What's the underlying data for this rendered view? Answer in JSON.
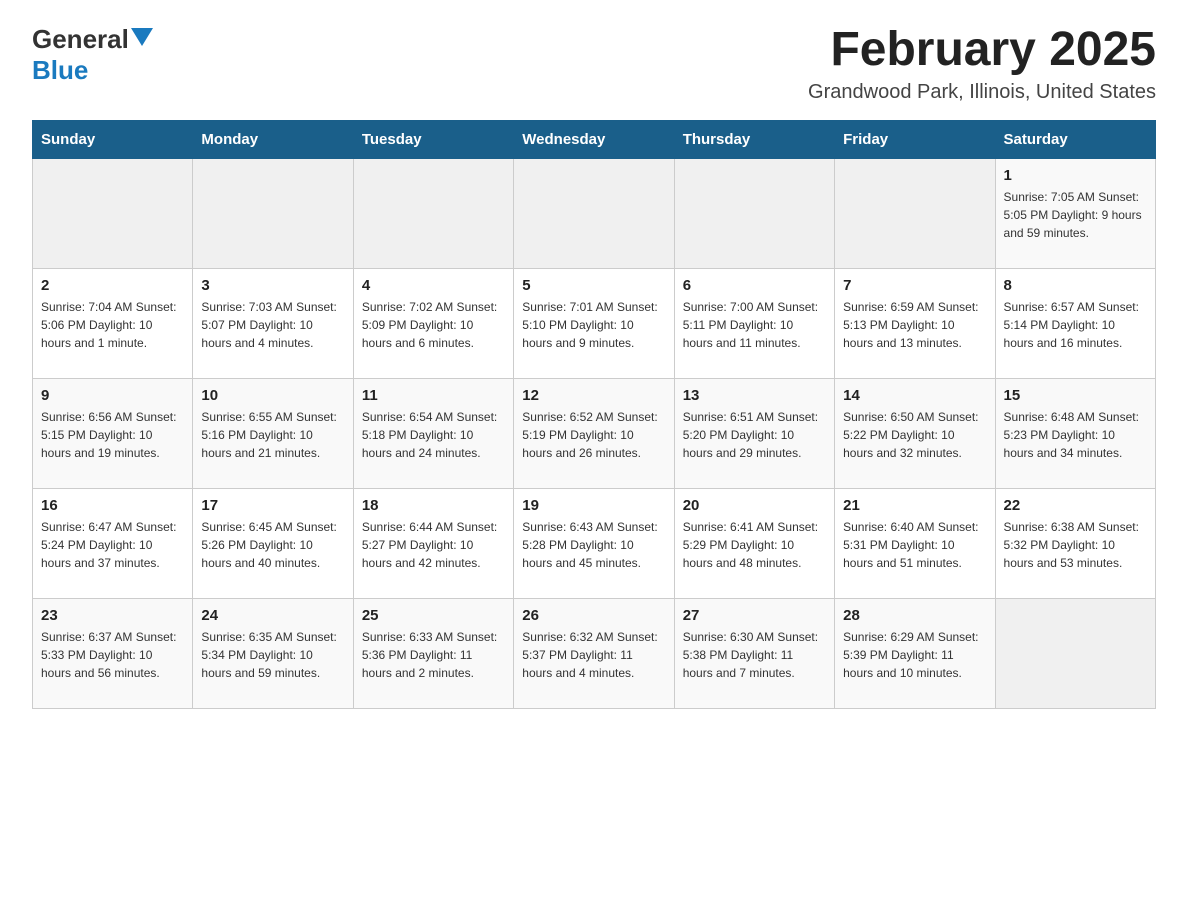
{
  "logo": {
    "general": "General",
    "blue": "Blue"
  },
  "title": "February 2025",
  "subtitle": "Grandwood Park, Illinois, United States",
  "days_of_week": [
    "Sunday",
    "Monday",
    "Tuesday",
    "Wednesday",
    "Thursday",
    "Friday",
    "Saturday"
  ],
  "weeks": [
    [
      {
        "day": "",
        "info": ""
      },
      {
        "day": "",
        "info": ""
      },
      {
        "day": "",
        "info": ""
      },
      {
        "day": "",
        "info": ""
      },
      {
        "day": "",
        "info": ""
      },
      {
        "day": "",
        "info": ""
      },
      {
        "day": "1",
        "info": "Sunrise: 7:05 AM\nSunset: 5:05 PM\nDaylight: 9 hours and 59 minutes."
      }
    ],
    [
      {
        "day": "2",
        "info": "Sunrise: 7:04 AM\nSunset: 5:06 PM\nDaylight: 10 hours and 1 minute."
      },
      {
        "day": "3",
        "info": "Sunrise: 7:03 AM\nSunset: 5:07 PM\nDaylight: 10 hours and 4 minutes."
      },
      {
        "day": "4",
        "info": "Sunrise: 7:02 AM\nSunset: 5:09 PM\nDaylight: 10 hours and 6 minutes."
      },
      {
        "day": "5",
        "info": "Sunrise: 7:01 AM\nSunset: 5:10 PM\nDaylight: 10 hours and 9 minutes."
      },
      {
        "day": "6",
        "info": "Sunrise: 7:00 AM\nSunset: 5:11 PM\nDaylight: 10 hours and 11 minutes."
      },
      {
        "day": "7",
        "info": "Sunrise: 6:59 AM\nSunset: 5:13 PM\nDaylight: 10 hours and 13 minutes."
      },
      {
        "day": "8",
        "info": "Sunrise: 6:57 AM\nSunset: 5:14 PM\nDaylight: 10 hours and 16 minutes."
      }
    ],
    [
      {
        "day": "9",
        "info": "Sunrise: 6:56 AM\nSunset: 5:15 PM\nDaylight: 10 hours and 19 minutes."
      },
      {
        "day": "10",
        "info": "Sunrise: 6:55 AM\nSunset: 5:16 PM\nDaylight: 10 hours and 21 minutes."
      },
      {
        "day": "11",
        "info": "Sunrise: 6:54 AM\nSunset: 5:18 PM\nDaylight: 10 hours and 24 minutes."
      },
      {
        "day": "12",
        "info": "Sunrise: 6:52 AM\nSunset: 5:19 PM\nDaylight: 10 hours and 26 minutes."
      },
      {
        "day": "13",
        "info": "Sunrise: 6:51 AM\nSunset: 5:20 PM\nDaylight: 10 hours and 29 minutes."
      },
      {
        "day": "14",
        "info": "Sunrise: 6:50 AM\nSunset: 5:22 PM\nDaylight: 10 hours and 32 minutes."
      },
      {
        "day": "15",
        "info": "Sunrise: 6:48 AM\nSunset: 5:23 PM\nDaylight: 10 hours and 34 minutes."
      }
    ],
    [
      {
        "day": "16",
        "info": "Sunrise: 6:47 AM\nSunset: 5:24 PM\nDaylight: 10 hours and 37 minutes."
      },
      {
        "day": "17",
        "info": "Sunrise: 6:45 AM\nSunset: 5:26 PM\nDaylight: 10 hours and 40 minutes."
      },
      {
        "day": "18",
        "info": "Sunrise: 6:44 AM\nSunset: 5:27 PM\nDaylight: 10 hours and 42 minutes."
      },
      {
        "day": "19",
        "info": "Sunrise: 6:43 AM\nSunset: 5:28 PM\nDaylight: 10 hours and 45 minutes."
      },
      {
        "day": "20",
        "info": "Sunrise: 6:41 AM\nSunset: 5:29 PM\nDaylight: 10 hours and 48 minutes."
      },
      {
        "day": "21",
        "info": "Sunrise: 6:40 AM\nSunset: 5:31 PM\nDaylight: 10 hours and 51 minutes."
      },
      {
        "day": "22",
        "info": "Sunrise: 6:38 AM\nSunset: 5:32 PM\nDaylight: 10 hours and 53 minutes."
      }
    ],
    [
      {
        "day": "23",
        "info": "Sunrise: 6:37 AM\nSunset: 5:33 PM\nDaylight: 10 hours and 56 minutes."
      },
      {
        "day": "24",
        "info": "Sunrise: 6:35 AM\nSunset: 5:34 PM\nDaylight: 10 hours and 59 minutes."
      },
      {
        "day": "25",
        "info": "Sunrise: 6:33 AM\nSunset: 5:36 PM\nDaylight: 11 hours and 2 minutes."
      },
      {
        "day": "26",
        "info": "Sunrise: 6:32 AM\nSunset: 5:37 PM\nDaylight: 11 hours and 4 minutes."
      },
      {
        "day": "27",
        "info": "Sunrise: 6:30 AM\nSunset: 5:38 PM\nDaylight: 11 hours and 7 minutes."
      },
      {
        "day": "28",
        "info": "Sunrise: 6:29 AM\nSunset: 5:39 PM\nDaylight: 11 hours and 10 minutes."
      },
      {
        "day": "",
        "info": ""
      }
    ]
  ]
}
